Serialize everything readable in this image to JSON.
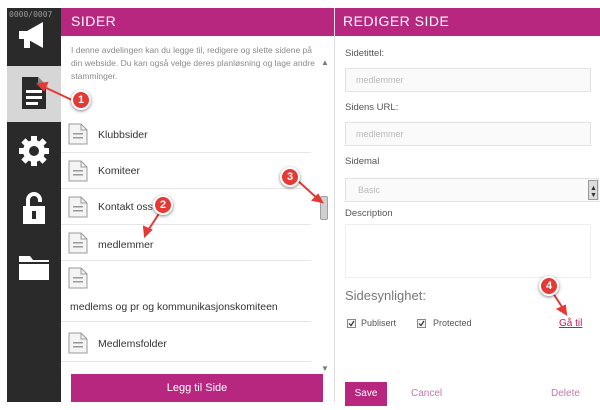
{
  "rail": {
    "id_text": "0000/0007",
    "tabs": [
      {
        "icon": "megaphone-icon",
        "active": false
      },
      {
        "icon": "document-icon",
        "active": true
      },
      {
        "icon": "gear-icon",
        "active": false
      },
      {
        "icon": "unlock-icon",
        "active": false
      },
      {
        "icon": "folder-icon",
        "active": false
      }
    ]
  },
  "sider": {
    "title": "SIDER",
    "description": "I denne avdelingen kan du legge til, redigere og slette sidene på din webside. Du kan også velge deres planløsning og lage andre stamminger.",
    "pages": [
      {
        "label": "Klubbsider"
      },
      {
        "label": "Komiteer"
      },
      {
        "label": "Kontakt oss"
      },
      {
        "label": "medlemmer"
      },
      {
        "label": "medlems og pr og kommunikasjonskomiteen"
      },
      {
        "label": "Medlemsfolder"
      }
    ],
    "add_button": "Legg til Side"
  },
  "rediger": {
    "title": "REDIGER SIDE",
    "page_title_label": "Sidetittel:",
    "page_title_value": "medlemmer",
    "url_label": "Sidens URL:",
    "url_value": "medlemmer",
    "template_label": "Sidemal",
    "template_value": "Basic",
    "description_label": "Description",
    "visibility_title": "Sidesynlighet:",
    "published_label": "Publisert",
    "protected_label": "Protected",
    "goto_link": "Gå til",
    "save": "Save",
    "cancel": "Cancel",
    "delete": "Delete"
  },
  "markers": [
    "1",
    "2",
    "3",
    "4"
  ],
  "colors": {
    "accent": "#b8277f",
    "marker": "#e53935",
    "rail": "#2a2a2a"
  }
}
